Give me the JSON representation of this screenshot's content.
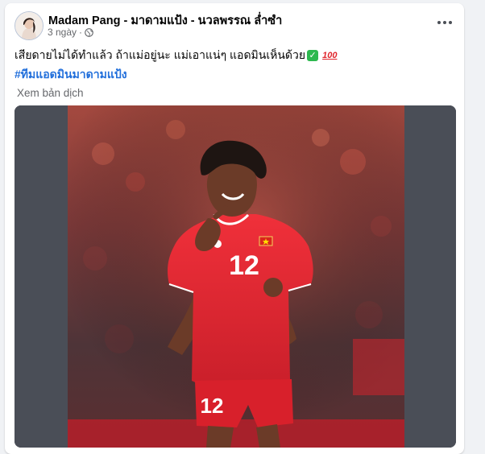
{
  "post": {
    "author": "Madam Pang - มาดามแป้ง - นวลพรรณ ล่ำซำ",
    "time": "3 ngày",
    "separator": "·",
    "privacy_icon": "globe-icon",
    "more_icon": "more-options-icon",
    "text": "เสียดายไม่ได้ทำแล้ว ถ้าแม่อยู่นะ แม่เอาแน่ๆ แอดมินเห็นด้วย",
    "emoji_check": "✓",
    "emoji_hundred": "100",
    "hashtag": "#ทีมแอดมินมาดามแป้ง",
    "translate": "Xem bản dịch",
    "jersey_number": "12"
  },
  "colors": {
    "hashtag": "#216fdb",
    "jersey": "#e0262d",
    "check": "#2eb84f"
  }
}
